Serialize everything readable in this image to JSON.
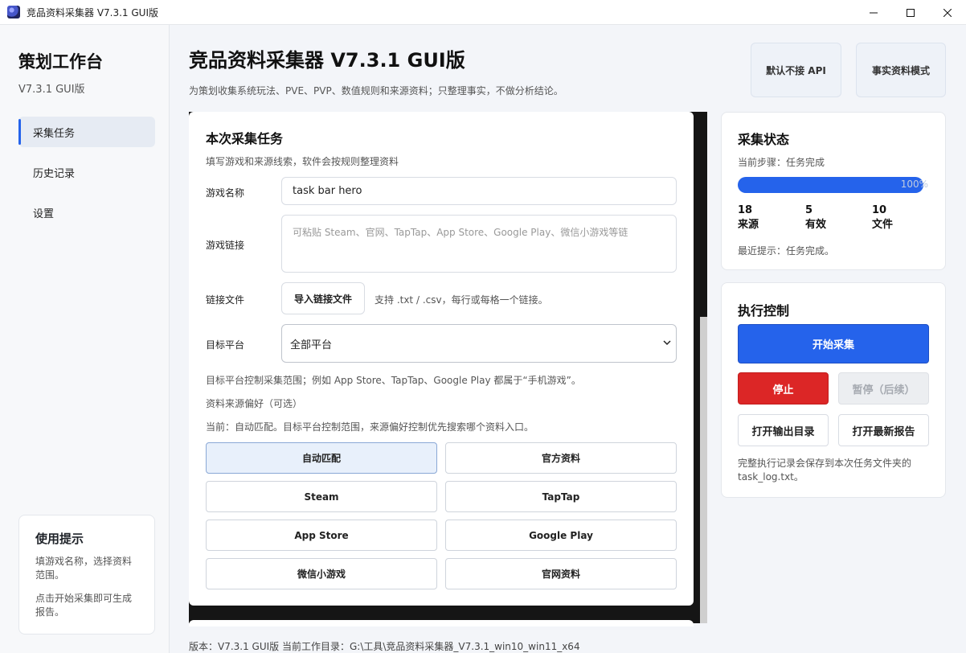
{
  "window": {
    "title": "竞品资料采集器 V7.3.1 GUI版",
    "controls": [
      "minimize",
      "maximize",
      "close"
    ]
  },
  "sidebar": {
    "brand": "策划工作台",
    "version": "V7.3.1 GUI版",
    "nav": [
      {
        "label": "采集任务",
        "active": true
      },
      {
        "label": "历史记录",
        "active": false
      },
      {
        "label": "设置",
        "active": false
      }
    ],
    "tips": {
      "title": "使用提示",
      "lines": [
        "填游戏名称，选择资料范围。",
        "点击开始采集即可生成报告。"
      ]
    }
  },
  "header": {
    "title": "竞品资料采集器 V7.3.1 GUI版",
    "subtitle": "为策划收集系统玩法、PVE、PVP、数值规则和来源资料；只整理事实，不做分析结论。",
    "badges": [
      "默认不接 API",
      "事实资料模式"
    ]
  },
  "task": {
    "title": "本次采集任务",
    "hint": "填写游戏和来源线索，软件会按规则整理资料",
    "game_name_label": "游戏名称",
    "game_name_value": "task bar hero",
    "game_link_label": "游戏链接",
    "game_link_placeholder": "可粘贴 Steam、官网、TapTap、App Store、Google Play、微信小游戏等链",
    "link_file_label": "链接文件",
    "import_button": "导入链接文件",
    "import_hint": "支持 .txt / .csv，每行或每格一个链接。",
    "platform_label": "目标平台",
    "platform_value": "全部平台",
    "platform_note": "目标平台控制采集范围；例如 App Store、TapTap、Google Play 都属于“手机游戏”。",
    "source_pref_label": "资料来源偏好（可选）",
    "source_current": "当前：自动匹配。目标平台控制范围，来源偏好控制优先搜索哪个资料入口。",
    "sources": [
      {
        "label": "自动匹配",
        "selected": true
      },
      {
        "label": "官方资料",
        "selected": false
      },
      {
        "label": "Steam",
        "selected": false
      },
      {
        "label": "TapTap",
        "selected": false
      },
      {
        "label": "App Store",
        "selected": false
      },
      {
        "label": "Google Play",
        "selected": false
      },
      {
        "label": "微信小游戏",
        "selected": false
      },
      {
        "label": "官网资料",
        "selected": false
      }
    ]
  },
  "status": {
    "title": "采集状态",
    "step": "当前步骤：任务完成",
    "progress_percent": 100,
    "progress_label": "100%",
    "stats": [
      {
        "value": "18",
        "label": "来源"
      },
      {
        "value": "5",
        "label": "有效"
      },
      {
        "value": "10",
        "label": "文件"
      }
    ],
    "last_hint": "最近提示：任务完成。"
  },
  "control": {
    "title": "执行控制",
    "start": "开始采集",
    "stop": "停止",
    "pause": "暂停（后续）",
    "open_output": "打开输出目录",
    "open_report": "打开最新报告",
    "note": "完整执行记录会保存到本次任务文件夹的 task_log.txt。"
  },
  "footer": {
    "text": "版本：V7.3.1 GUI版    当前工作目录：G:\\工具\\竞品资料采集器_V7.3.1_win10_win11_x64"
  },
  "colors": {
    "accent": "#2563eb",
    "danger": "#dc2626",
    "selected_bg": "#e8f0fb"
  }
}
